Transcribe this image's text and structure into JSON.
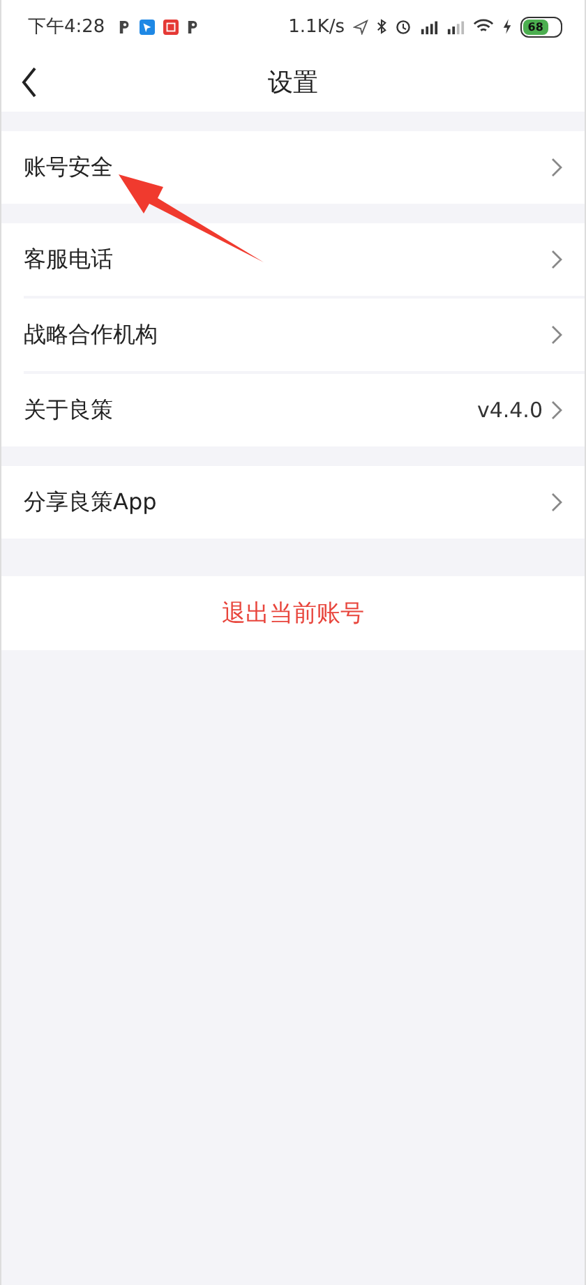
{
  "status_bar": {
    "time": "下午4:28",
    "speed": "1.1K/s",
    "battery": "68"
  },
  "nav": {
    "title": "设置"
  },
  "groups": [
    {
      "items": [
        {
          "label": "账号安全"
        }
      ]
    },
    {
      "items": [
        {
          "label": "客服电话"
        },
        {
          "label": "战略合作机构"
        },
        {
          "label": "关于良策",
          "value": "v4.4.0"
        }
      ]
    },
    {
      "items": [
        {
          "label": "分享良策App"
        }
      ]
    }
  ],
  "logout": {
    "label": "退出当前账号"
  }
}
